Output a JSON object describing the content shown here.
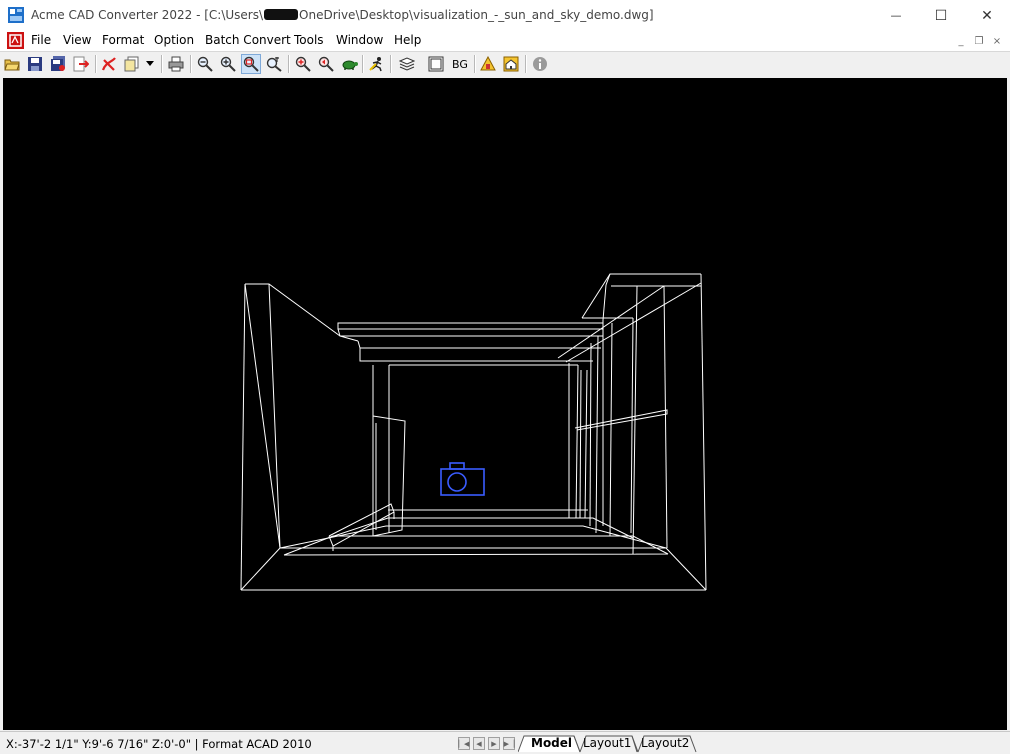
{
  "window": {
    "app_title": "Acme CAD Converter 2022",
    "path_prefix": " - [C:\\Users\\",
    "path_suffix": "OneDrive\\Desktop\\visualization_-_sun_and_sky_demo.dwg]",
    "minimize_glyph": "—",
    "maximize_glyph": "☐",
    "close_glyph": "✕"
  },
  "menu": {
    "items": [
      "File",
      "View",
      "Format",
      "Option",
      "Batch Convert",
      "Tools",
      "Window",
      "Help"
    ]
  },
  "mdi": {
    "minimize": "_",
    "restore": "❐",
    "close": "×"
  },
  "toolbar": {
    "bg_label": "BG"
  },
  "status": {
    "coordinates": "X:-37'-2 1/1\" Y:9'-6 7/16\" Z:0'-0\" | Format ACAD 2010",
    "tabs": [
      "Model",
      "Layout1",
      "Layout2"
    ],
    "active_tab": "Model"
  },
  "colors": {
    "canvas_bg": "#000000",
    "wireframe": "#ffffff",
    "camera": "#3a5cff",
    "menu_icon_red": "#cc1111"
  }
}
